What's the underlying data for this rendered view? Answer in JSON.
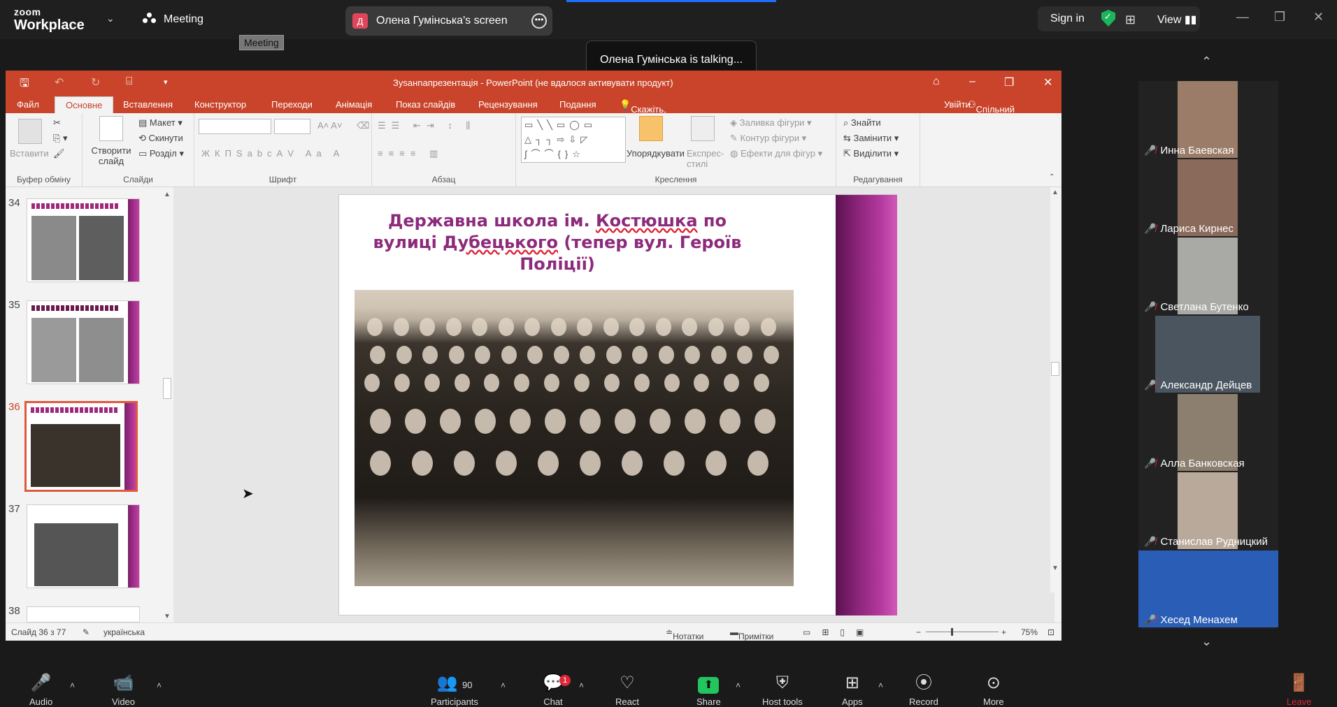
{
  "zoom": {
    "logo_line1": "zoom",
    "logo_line2": "Workplace",
    "meeting_label": "Meeting",
    "meeting_tooltip": "Meeting",
    "share_initial": "Д",
    "share_title": "Олена Гумінська's screen",
    "sign_in": "Sign in",
    "view": "View",
    "talking_toast": "Олена Гумінська is talking..."
  },
  "ppt": {
    "title": "Зуsанnапрезентація - PowerPoint (не вдалося активувати продукт)",
    "tabs": [
      "Файл",
      "Основне",
      "Вставлення",
      "Конструктор",
      "Переходи",
      "Анімація",
      "Показ слайдів",
      "Рецензування",
      "Подання"
    ],
    "tell_me": "Скажіть, що потрібно зробити...",
    "sign_in": "Увійти",
    "share": "Спільний доступ",
    "ribbon": {
      "clipboard": {
        "paste": "Вставити",
        "label": "Буфер обміну"
      },
      "slides": {
        "new_slide": "Створити слайд",
        "layout": "Макет",
        "reset": "Скинути",
        "section": "Розділ",
        "label": "Слайди"
      },
      "font": {
        "label": "Шрифт"
      },
      "paragraph": {
        "label": "Абзац"
      },
      "drawing": {
        "arrange": "Упорядкувати",
        "quick_styles": "Експрес-стилі",
        "fill": "Заливка фігури",
        "outline": "Контур фігури",
        "effects": "Ефекти для фігур",
        "label": "Креслення"
      },
      "editing": {
        "find": "Знайти",
        "replace": "Замінити",
        "select": "Виділити",
        "label": "Редагування"
      }
    },
    "thumb_numbers": [
      "34",
      "35",
      "36",
      "37",
      "38"
    ],
    "slide_title_part1": "Державна школа ім. ",
    "slide_title_u1": "Костюшка",
    "slide_title_part2": " по вулиці ",
    "slide_title_u2": "Дубецького",
    "slide_title_part3": " (тепер вул. Героїв Поліції)",
    "status": {
      "slide_info": "Слайд 36 з 77",
      "language": "українська",
      "notes": "Нотатки",
      "comments": "Примітки",
      "zoom": "75%"
    }
  },
  "participants": [
    {
      "name": "Инна Баевская",
      "video_color": "#9a7c68"
    },
    {
      "name": "Лариса Кирнес",
      "video_color": "#8a6a5a"
    },
    {
      "name": "Светлана Бутенко",
      "video_color": "#a9a9a5"
    },
    {
      "name": "Александр Дейцев",
      "video_color": "#4a5560"
    },
    {
      "name": "Алла Банковская",
      "video_color": "#8c7f70"
    },
    {
      "name": "Станислав Рудницкий",
      "video_color": "#b9a99a"
    },
    {
      "name": "Хесед Менахем",
      "video_color": "#2a5db5"
    }
  ],
  "toolbar": {
    "audio": "Audio",
    "video": "Video",
    "participants": "Participants",
    "participants_count": "90",
    "chat": "Chat",
    "chat_badge": "1",
    "react": "React",
    "share": "Share",
    "host_tools": "Host tools",
    "apps": "Apps",
    "record": "Record",
    "more": "More",
    "leave": "Leave"
  },
  "colors": {
    "ppt_accent": "#c9442a",
    "slide_title": "#8c2a7c",
    "share_green": "#22c55e",
    "muted_red": "#e0273a"
  }
}
